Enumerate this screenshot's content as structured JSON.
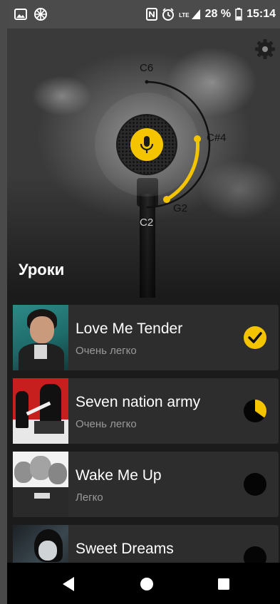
{
  "status_bar": {
    "battery": "28 %",
    "time": "15:14",
    "network": "LTE",
    "icons": [
      "image-icon",
      "pinwheel-icon",
      "nfc-icon",
      "alarm-icon",
      "signal-icon",
      "battery-icon"
    ]
  },
  "hero": {
    "settings_icon": "gear-icon",
    "mic_icon": "microphone-icon",
    "range": {
      "top_note": "C6",
      "bottom_note": "C2",
      "upper_note": "C#4",
      "lower_note": "G2"
    },
    "section_title": "Уроки"
  },
  "colors": {
    "accent": "#f5c400",
    "card": "#2d2d2d",
    "list_bg": "#1b1b1b",
    "muted_text": "#9a9a9a"
  },
  "songs": [
    {
      "title": "Love Me Tender",
      "level": "Очень легко",
      "progress": 1.0,
      "status": "completed"
    },
    {
      "title": "Seven nation army",
      "level": "Очень легко",
      "progress": 0.35,
      "status": "in-progress"
    },
    {
      "title": "Wake Me Up",
      "level": "Легко",
      "progress": 0.0,
      "status": "not-started"
    },
    {
      "title": "Sweet Dreams",
      "level": "",
      "progress": 0.0,
      "status": "not-started"
    }
  ],
  "nav": {
    "back_icon": "back-triangle-icon",
    "home_icon": "home-circle-icon",
    "recents_icon": "recents-square-icon"
  }
}
